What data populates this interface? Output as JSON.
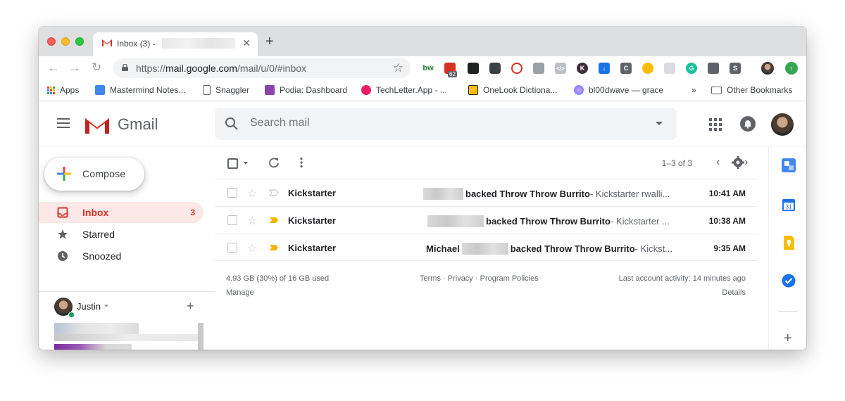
{
  "browser": {
    "tab_title": "Inbox (3) -",
    "url_scheme": "https://",
    "url_domain": "mail.google.com",
    "url_path": "/mail/u/0/#inbox",
    "extension_badge": "62",
    "bookmarks": [
      {
        "label": "Apps"
      },
      {
        "label": "Mastermind Notes..."
      },
      {
        "label": "Snaggler"
      },
      {
        "label": "Podia: Dashboard"
      },
      {
        "label": "TechLetter.App - ..."
      },
      {
        "label": "OneLook Dictiona..."
      },
      {
        "label": "bl00dwave — grace"
      }
    ],
    "bookmarks_overflow": "»",
    "other_bookmarks": "Other Bookmarks"
  },
  "gmail": {
    "logo_text": "Gmail",
    "search_placeholder": "Search mail",
    "compose_label": "Compose",
    "nav": [
      {
        "label": "Inbox",
        "count": "3",
        "icon": "inbox-icon"
      },
      {
        "label": "Starred",
        "count": "",
        "icon": "star-icon"
      },
      {
        "label": "Snoozed",
        "count": "",
        "icon": "clock-icon"
      }
    ],
    "hangouts_user": "Justin",
    "pagination": "1–3 of 3",
    "emails": [
      {
        "sender": "Kickstarter",
        "name_prefix": "",
        "subject": "backed Throw Throw Burrito",
        "snippet": " - Kickstarter rwalli...",
        "time": "10:41 AM",
        "important": false
      },
      {
        "sender": "Kickstarter",
        "name_prefix": "",
        "subject": "backed Throw Throw Burrito",
        "snippet": " - Kickstarter ...",
        "time": "10:38 AM",
        "important": true
      },
      {
        "sender": "Kickstarter",
        "name_prefix": "Michael",
        "subject": "backed Throw Throw Burrito",
        "snippet": " - Kickst...",
        "time": "9:35 AM",
        "important": true
      }
    ],
    "footer": {
      "storage": "4.93 GB (30%) of 16 GB used",
      "manage": "Manage",
      "terms": "Terms",
      "sep1": "·",
      "privacy": "Privacy",
      "sep2": "·",
      "policies": "Program Policies",
      "activity": "Last account activity: 14 minutes ago",
      "details": "Details"
    }
  },
  "colors": {
    "gmail_red": "#d93025",
    "inbox_active_bg": "#fce8e6",
    "important_yellow": "#f4b400"
  }
}
